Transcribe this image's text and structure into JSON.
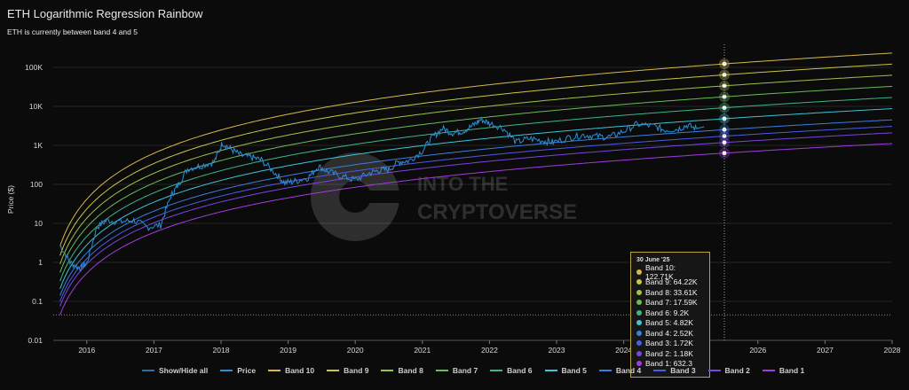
{
  "title": "ETH Logarithmic Regression Rainbow",
  "subtitle": "ETH is currently between band 4 and 5",
  "watermark": {
    "line1": "INTO THE",
    "line2": "CRYPTOVERSE"
  },
  "colors": {
    "background": "#0b0b0b",
    "price": "#2a8fd6",
    "band10": "#d8b94a",
    "band9": "#c9c64a",
    "band8": "#9fc24a",
    "band7": "#6bbb5a",
    "band6": "#3eb58a",
    "band5": "#3cc6d8",
    "band4": "#3b7fe0",
    "band3": "#4a5de6",
    "band2": "#7a45e0",
    "band1": "#a33ce0"
  },
  "legend": [
    {
      "label": "Show/Hide all",
      "color": "#2a6f9e"
    },
    {
      "label": "Price",
      "color": "#2a8fd6"
    },
    {
      "label": "Band 10",
      "color": "#d8b94a"
    },
    {
      "label": "Band 9",
      "color": "#c9c64a"
    },
    {
      "label": "Band 8",
      "color": "#9fc24a"
    },
    {
      "label": "Band 7",
      "color": "#6bbb5a"
    },
    {
      "label": "Band 6",
      "color": "#3eb58a"
    },
    {
      "label": "Band 5",
      "color": "#3cc6d8"
    },
    {
      "label": "Band 4",
      "color": "#3b7fe0"
    },
    {
      "label": "Band 3",
      "color": "#4a5de6"
    },
    {
      "label": "Band 2",
      "color": "#7a45e0"
    },
    {
      "label": "Band 1",
      "color": "#a33ce0"
    }
  ],
  "tooltip": {
    "date": "30 June '25",
    "rows": [
      {
        "label": "Band 10: 122.71K",
        "color": "#d8b94a"
      },
      {
        "label": "Band 9: 64.22K",
        "color": "#c9c64a"
      },
      {
        "label": "Band 8: 33.61K",
        "color": "#9fc24a"
      },
      {
        "label": "Band 7: 17.59K",
        "color": "#6bbb5a"
      },
      {
        "label": "Band 6: 9.2K",
        "color": "#3eb58a"
      },
      {
        "label": "Band 5: 4.82K",
        "color": "#3cc6d8"
      },
      {
        "label": "Band 4: 2.52K",
        "color": "#3b7fe0"
      },
      {
        "label": "Band 3: 1.72K",
        "color": "#4a5de6"
      },
      {
        "label": "Band 2: 1.18K",
        "color": "#7a45e0"
      },
      {
        "label": "Band 1: 632.3",
        "color": "#a33ce0"
      }
    ]
  },
  "chart_data": {
    "type": "line",
    "title": "ETH Logarithmic Regression Rainbow",
    "subtitle": "ETH is currently between band 4 and 5",
    "ylabel": "Price ($)",
    "yscale": "log",
    "ylim": [
      0.01,
      300000
    ],
    "xlim": [
      2015.5,
      2028.0
    ],
    "y_ticks": [
      {
        "value": 0.01,
        "label": "0.01"
      },
      {
        "value": 0.1,
        "label": "0.1"
      },
      {
        "value": 1,
        "label": "1"
      },
      {
        "value": 10,
        "label": "10"
      },
      {
        "value": 100,
        "label": "100"
      },
      {
        "value": 1000,
        "label": "1K"
      },
      {
        "value": 10000,
        "label": "10K"
      },
      {
        "value": 100000,
        "label": "100K"
      }
    ],
    "x_ticks": [
      "2016",
      "2017",
      "2018",
      "2019",
      "2020",
      "2021",
      "2022",
      "2023",
      "2024",
      "2025",
      "2026",
      "2027",
      "2028"
    ],
    "grid": true,
    "legend_position": "bottom",
    "reference_line": {
      "y": 0.045,
      "style": "dotted"
    },
    "crosshair_x": 2025.5,
    "price": {
      "name": "Price",
      "x": [
        2015.6,
        2015.75,
        2015.9,
        2016.0,
        2016.15,
        2016.3,
        2016.5,
        2016.7,
        2016.9,
        2017.1,
        2017.25,
        2017.35,
        2017.5,
        2017.7,
        2017.9,
        2018.02,
        2018.15,
        2018.3,
        2018.45,
        2018.6,
        2018.8,
        2018.95,
        2019.1,
        2019.3,
        2019.45,
        2019.6,
        2019.8,
        2020.0,
        2020.2,
        2020.35,
        2020.5,
        2020.65,
        2020.8,
        2021.0,
        2021.15,
        2021.3,
        2021.45,
        2021.6,
        2021.75,
        2021.87,
        2022.0,
        2022.2,
        2022.4,
        2022.6,
        2022.8,
        2022.95,
        2023.2,
        2023.4,
        2023.6,
        2023.8,
        2024.0,
        2024.2,
        2024.45,
        2024.6,
        2024.8,
        2024.95,
        2025.1
      ],
      "y": [
        2.8,
        1.0,
        0.7,
        0.95,
        8,
        12,
        11,
        12,
        8,
        9,
        50,
        90,
        250,
        300,
        380,
        1150,
        800,
        550,
        500,
        420,
        200,
        110,
        120,
        150,
        290,
        210,
        160,
        130,
        190,
        230,
        240,
        380,
        400,
        730,
        1600,
        2700,
        2100,
        2300,
        3200,
        4600,
        3700,
        2800,
        1200,
        1500,
        1300,
        1200,
        1600,
        1850,
        1700,
        1650,
        2300,
        3500,
        3100,
        2500,
        2600,
        3300,
        2600
      ],
      "end": {
        "x": 2025.2,
        "y": 3000
      }
    },
    "bands": [
      {
        "name": "Band 10",
        "value_at_2025_5": 122710,
        "start_value_2015_6": 2.6
      },
      {
        "name": "Band 9",
        "value_at_2025_5": 64220,
        "start_value_2015_6": 1.5
      },
      {
        "name": "Band 8",
        "value_at_2025_5": 33610,
        "start_value_2015_6": 0.9
      },
      {
        "name": "Band 7",
        "value_at_2025_5": 17590,
        "start_value_2015_6": 0.55
      },
      {
        "name": "Band 6",
        "value_at_2025_5": 9200,
        "start_value_2015_6": 0.33
      },
      {
        "name": "Band 5",
        "value_at_2025_5": 4820,
        "start_value_2015_6": 0.21
      },
      {
        "name": "Band 4",
        "value_at_2025_5": 2520,
        "start_value_2015_6": 0.14
      },
      {
        "name": "Band 3",
        "value_at_2025_5": 1720,
        "start_value_2015_6": 0.1
      },
      {
        "name": "Band 2",
        "value_at_2025_5": 1180,
        "start_value_2015_6": 0.075
      },
      {
        "name": "Band 1",
        "value_at_2025_5": 632.3,
        "start_value_2015_6": 0.045
      }
    ]
  }
}
